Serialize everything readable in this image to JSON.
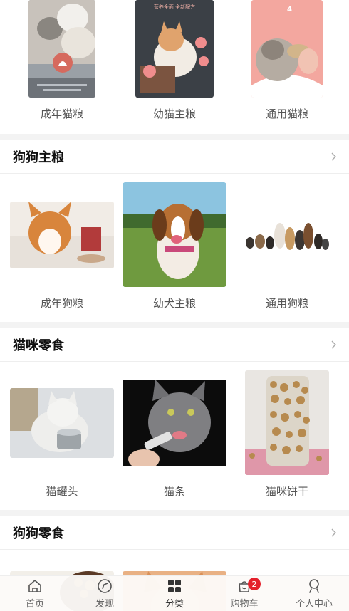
{
  "top_row": {
    "items": [
      {
        "label": "成年猫粮"
      },
      {
        "label": "幼猫主粮",
        "poster_text_1": "营养全面 全新配方"
      },
      {
        "label": "通用猫粮",
        "poster_text_1": "4"
      }
    ]
  },
  "sections": [
    {
      "title": "狗狗主粮",
      "items": [
        {
          "label": "成年狗粮"
        },
        {
          "label": "幼犬主粮"
        },
        {
          "label": "通用狗粮"
        }
      ]
    },
    {
      "title": "猫咪零食",
      "items": [
        {
          "label": "猫罐头"
        },
        {
          "label": "猫条"
        },
        {
          "label": "猫咪饼干"
        }
      ]
    },
    {
      "title": "狗狗零食",
      "items": []
    }
  ],
  "tabbar": {
    "tabs": [
      {
        "label": "首页",
        "icon": "home-icon"
      },
      {
        "label": "发现",
        "icon": "compass-icon"
      },
      {
        "label": "分类",
        "icon": "grid-icon",
        "active": true
      },
      {
        "label": "购物车",
        "icon": "cart-icon",
        "badge": "2"
      },
      {
        "label": "个人中心",
        "icon": "user-icon"
      }
    ]
  },
  "colors": {
    "badge": "#e4202c",
    "divider": "#f3f3f3",
    "accent_pink": "#f19b93"
  }
}
